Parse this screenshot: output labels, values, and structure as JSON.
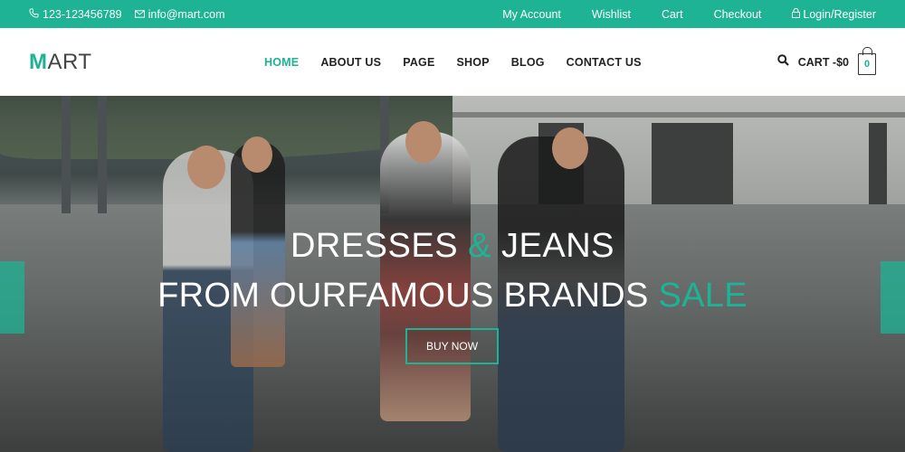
{
  "topbar": {
    "phone": "123-123456789",
    "email": "info@mart.com",
    "links": [
      "My Account",
      "Wishlist",
      "Cart",
      "Checkout"
    ],
    "login": "Login/Register"
  },
  "header": {
    "logo_first": "M",
    "logo_rest": "ART",
    "nav": [
      "HOME",
      "ABOUT US",
      "PAGE",
      "SHOP",
      "BLOG",
      "CONTACT US"
    ],
    "cart_label": "CART -$0",
    "cart_count": "0"
  },
  "hero": {
    "line1_a": "DRESSES ",
    "line1_amp": "&",
    "line1_b": " JEANS",
    "line2_a": "FROM OURFAMOUS BRANDS ",
    "line2_sale": "SALE",
    "button": "BUY NOW"
  },
  "colors": {
    "accent": "#1db394"
  }
}
